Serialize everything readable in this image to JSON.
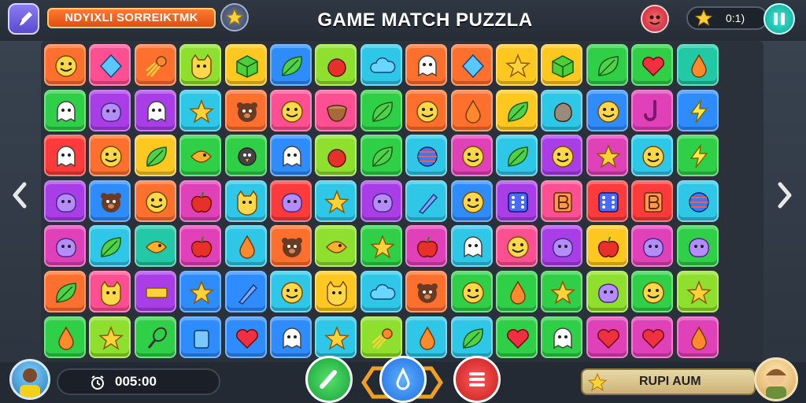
{
  "header": {
    "level_label": "NDYIXLI SORREIKTMK",
    "title": "GAME MATCH PUZZLA",
    "score": "0:1)"
  },
  "footer": {
    "timer": "005:00",
    "reward_label": "RUPI AUM"
  },
  "colors": {
    "orange": "#ff6f2e",
    "pink": "#ff4f93",
    "red": "#ff3a3a",
    "lime": "#8fe02e",
    "yellow": "#ffc820",
    "blue": "#2f8cff",
    "cyan": "#2fc7e8",
    "green": "#2fcf48",
    "purple": "#a93ee8",
    "magenta": "#e041b8",
    "teal": "#21c9a6"
  },
  "board": {
    "rows": [
      [
        [
          "orange",
          "smiley-face-icon"
        ],
        [
          "pink",
          "diamond-gem-icon"
        ],
        [
          "orange",
          "comet-icon"
        ],
        [
          "lime",
          "cat-face-icon"
        ],
        [
          "yellow",
          "cube-icon"
        ],
        [
          "blue",
          "leaf-icon"
        ],
        [
          "lime",
          "tomato-icon"
        ],
        [
          "cyan",
          "cloud-icon"
        ],
        [
          "orange",
          "ghost-face-icon"
        ],
        [
          "orange",
          "diamond-gem-icon"
        ],
        [
          "yellow",
          "star-icon"
        ],
        [
          "yellow",
          "cube-icon"
        ],
        [
          "green",
          "leaf-icon"
        ],
        [
          "green",
          "heart-icon"
        ],
        [
          "teal",
          "drop-icon"
        ]
      ],
      [
        [
          "green",
          "ghost-face-icon"
        ],
        [
          "purple",
          "blob-face-icon"
        ],
        [
          "purple",
          "ghost-face-icon"
        ],
        [
          "cyan",
          "star-icon"
        ],
        [
          "orange",
          "bear-face-icon"
        ],
        [
          "pink",
          "smiley-face-icon"
        ],
        [
          "pink",
          "bowl-icon"
        ],
        [
          "green",
          "leaf-icon"
        ],
        [
          "orange",
          "smiley-face-icon"
        ],
        [
          "orange",
          "drop-icon"
        ],
        [
          "yellow",
          "leaf-icon"
        ],
        [
          "cyan",
          "stone-icon"
        ],
        [
          "blue",
          "smiley-face-icon"
        ],
        [
          "magenta",
          "hook-icon"
        ],
        [
          "blue",
          "bolt-icon"
        ]
      ],
      [
        [
          "red",
          "ghost-face-icon"
        ],
        [
          "orange",
          "smiley-face-icon"
        ],
        [
          "yellow",
          "leaf-icon"
        ],
        [
          "green",
          "fish-face-icon"
        ],
        [
          "green",
          "bird-face-icon"
        ],
        [
          "blue",
          "ghost-face-icon"
        ],
        [
          "lime",
          "tomato-icon"
        ],
        [
          "green",
          "leaf-icon"
        ],
        [
          "cyan",
          "ball-icon"
        ],
        [
          "magenta",
          "smiley-face-icon"
        ],
        [
          "cyan",
          "leaf-icon"
        ],
        [
          "purple",
          "smiley-face-icon"
        ],
        [
          "magenta",
          "star-icon"
        ],
        [
          "cyan",
          "smiley-face-icon"
        ],
        [
          "green",
          "bolt-icon"
        ]
      ],
      [
        [
          "purple",
          "blob-face-icon"
        ],
        [
          "blue",
          "bear-face-icon"
        ],
        [
          "orange",
          "smiley-face-icon"
        ],
        [
          "magenta",
          "apple-icon"
        ],
        [
          "cyan",
          "cat-face-icon"
        ],
        [
          "red",
          "blob-face-icon"
        ],
        [
          "cyan",
          "star-icon"
        ],
        [
          "purple",
          "blob-face-icon"
        ],
        [
          "cyan",
          "pencil-icon"
        ],
        [
          "blue",
          "smiley-face-icon"
        ],
        [
          "purple",
          "dice-icon"
        ],
        [
          "pink",
          "letter-icon"
        ],
        [
          "red",
          "dice-icon"
        ],
        [
          "red",
          "letter-icon"
        ],
        [
          "cyan",
          "ball-icon"
        ]
      ],
      [
        [
          "magenta",
          "blob-face-icon"
        ],
        [
          "cyan",
          "leaf-icon"
        ],
        [
          "teal",
          "fish-face-icon"
        ],
        [
          "magenta",
          "apple-icon"
        ],
        [
          "cyan",
          "drop-icon"
        ],
        [
          "orange",
          "bear-face-icon"
        ],
        [
          "lime",
          "fish-face-icon"
        ],
        [
          "green",
          "star-icon"
        ],
        [
          "magenta",
          "apple-icon"
        ],
        [
          "cyan",
          "ghost-face-icon"
        ],
        [
          "pink",
          "smiley-face-icon"
        ],
        [
          "purple",
          "blob-face-icon"
        ],
        [
          "yellow",
          "apple-icon"
        ],
        [
          "magenta",
          "blob-face-icon"
        ],
        [
          "green",
          "blob-face-icon"
        ]
      ],
      [
        [
          "orange",
          "leaf-icon"
        ],
        [
          "pink",
          "cat-face-icon"
        ],
        [
          "purple",
          "bar-icon"
        ],
        [
          "blue",
          "star-icon"
        ],
        [
          "blue",
          "pencil-icon"
        ],
        [
          "cyan",
          "smiley-face-icon"
        ],
        [
          "yellow",
          "cat-face-icon"
        ],
        [
          "cyan",
          "cloud-icon"
        ],
        [
          "orange",
          "bear-face-icon"
        ],
        [
          "green",
          "smiley-face-icon"
        ],
        [
          "green",
          "drop-icon"
        ],
        [
          "green",
          "star-icon"
        ],
        [
          "lime",
          "blob-face-icon"
        ],
        [
          "green",
          "smiley-face-icon"
        ],
        [
          "lime",
          "star-icon"
        ]
      ],
      [
        [
          "green",
          "drop-icon"
        ],
        [
          "lime",
          "star-icon"
        ],
        [
          "green",
          "whisk-icon"
        ],
        [
          "blue",
          "cup-icon"
        ],
        [
          "blue",
          "heart-icon"
        ],
        [
          "blue",
          "ghost-face-icon"
        ],
        [
          "cyan",
          "star-icon"
        ],
        [
          "lime",
          "comet-icon"
        ],
        [
          "cyan",
          "drop-icon"
        ],
        [
          "cyan",
          "leaf-icon"
        ],
        [
          "green",
          "heart-icon"
        ],
        [
          "green",
          "ghost-face-icon"
        ],
        [
          "magenta",
          "heart-icon"
        ],
        [
          "magenta",
          "heart-icon"
        ],
        [
          "magenta",
          "drop-icon"
        ]
      ]
    ]
  }
}
